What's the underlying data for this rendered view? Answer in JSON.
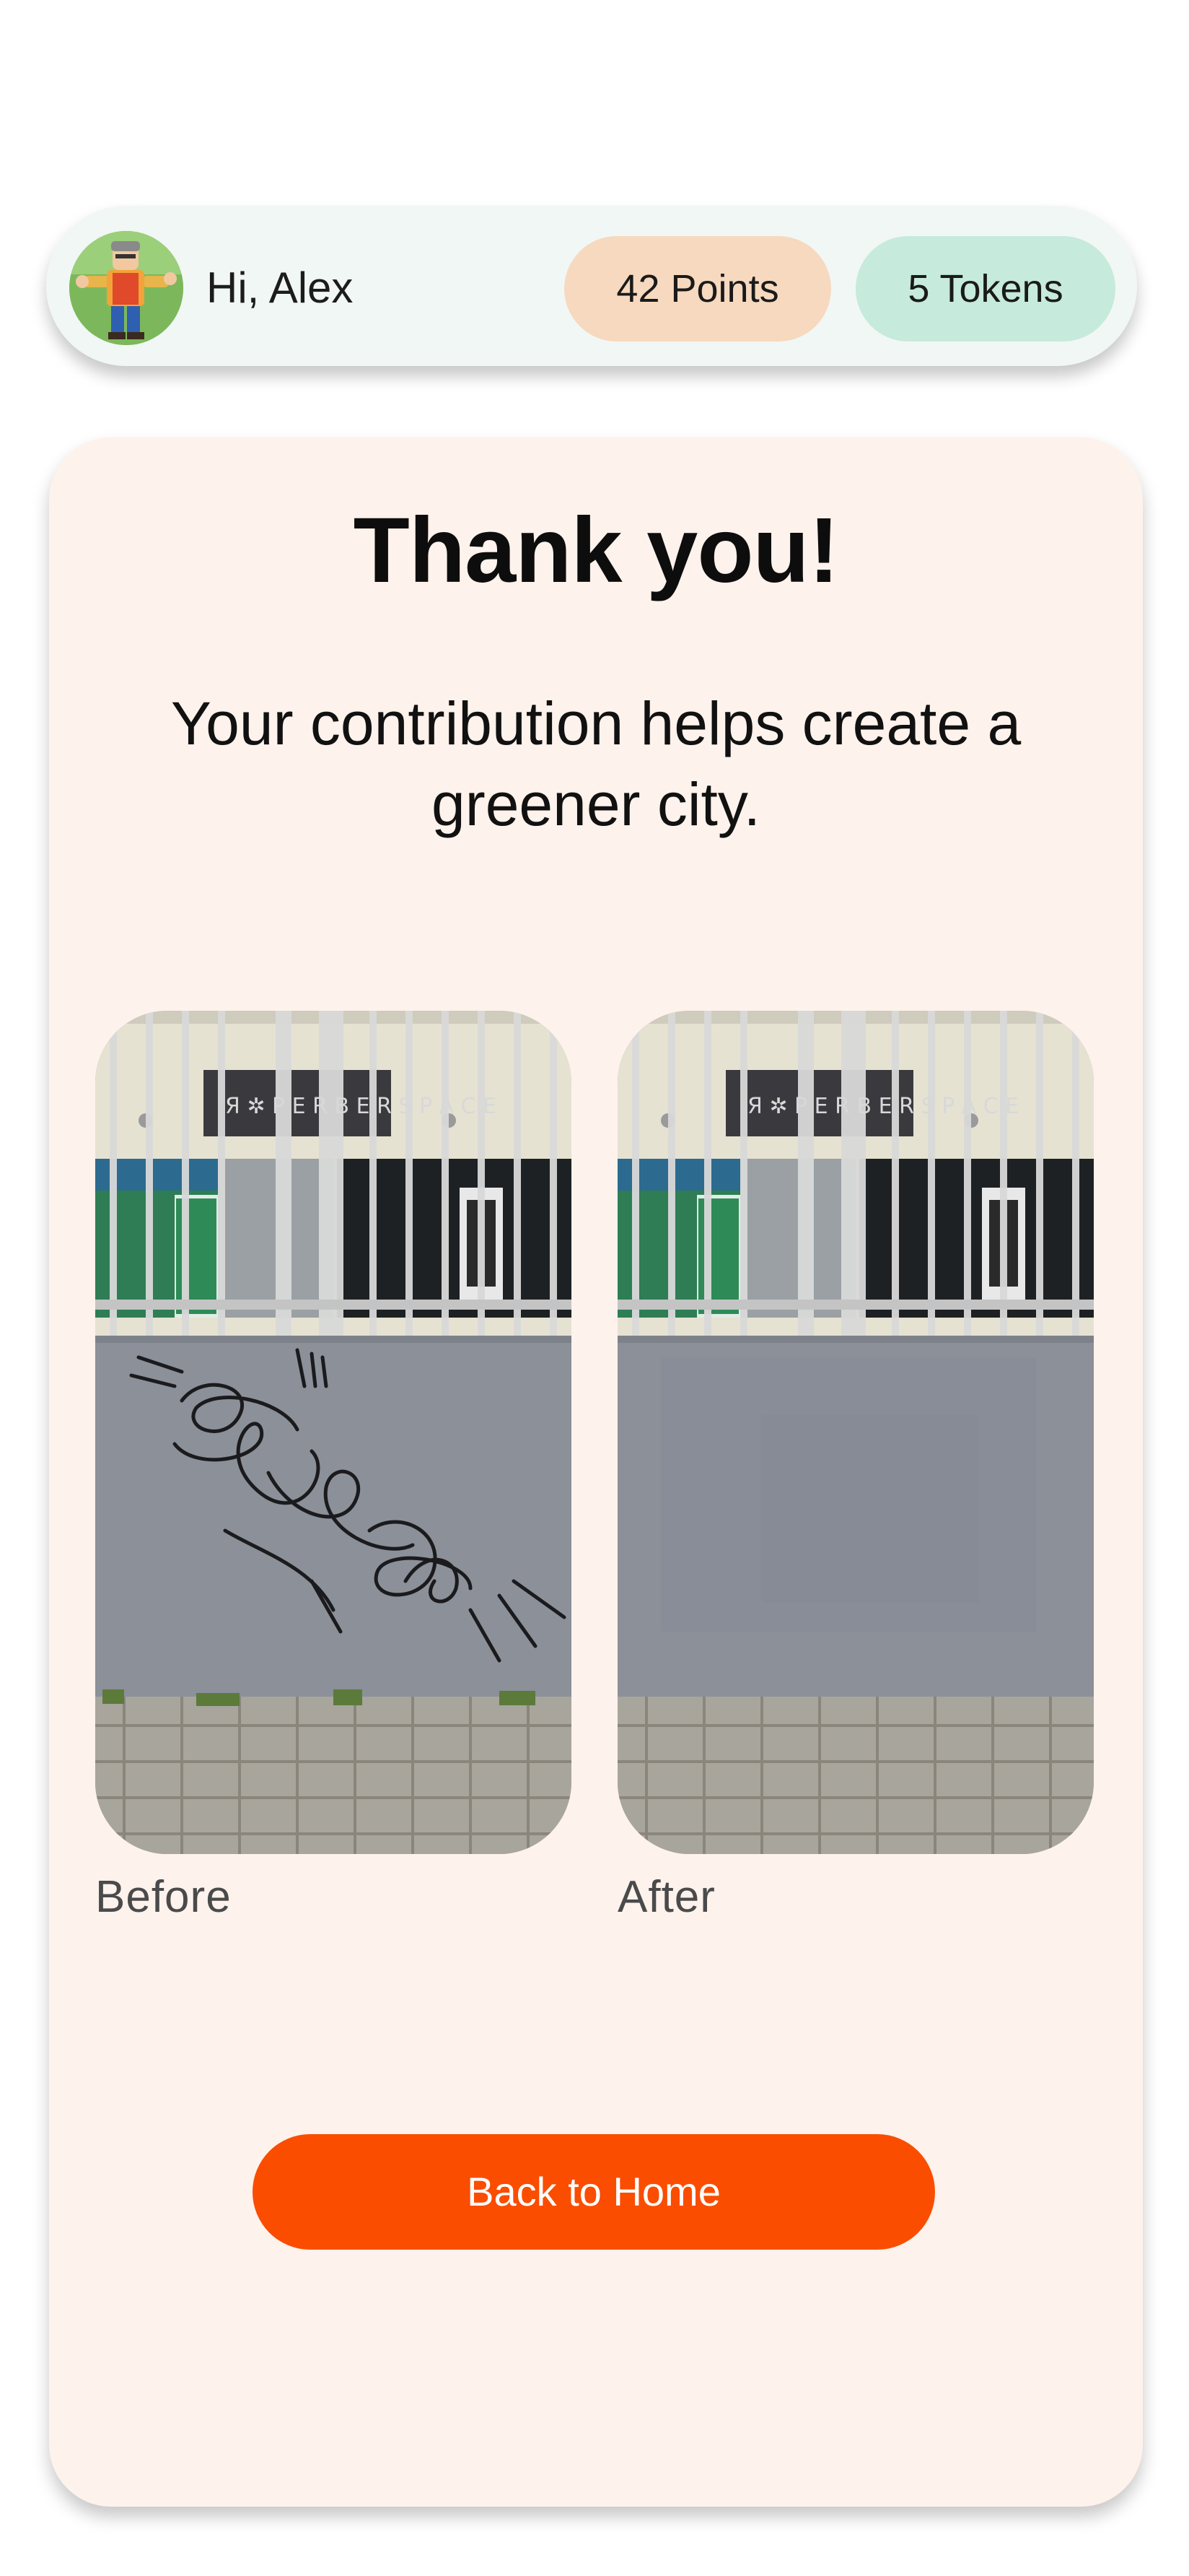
{
  "header": {
    "greeting": "Hi, Alex",
    "points_label": "42 Points",
    "tokens_label": "5 Tokens",
    "avatar_icon": "character-avatar-icon"
  },
  "main": {
    "title": "Thank you!",
    "subtitle": "Your contribution helps create a greener city.",
    "before_caption": "Before",
    "after_caption": "After",
    "photo_before_icon": "graffiti-wall-photo",
    "photo_after_icon": "clean-wall-photo",
    "home_button_label": "Back to Home"
  },
  "colors": {
    "accent": "#fa4d00",
    "points_pill": "#f6d9bf",
    "tokens_pill": "#c6eadb",
    "card_background": "#fdf2ec",
    "header_background": "#f1f7f4"
  }
}
